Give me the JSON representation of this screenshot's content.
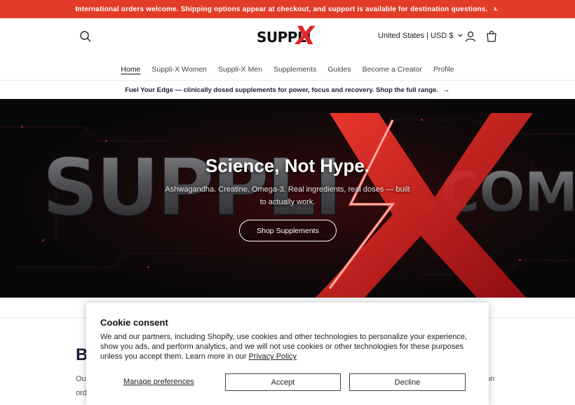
{
  "announcement": {
    "text": "International orders welcome. Shipping options appear at checkout, and support is available for destination questions.",
    "arrow": "→",
    "prev": "‹",
    "next": "›"
  },
  "header": {
    "logo_text": "SUPPLI",
    "logo_x": "X",
    "country_selector": "United States | USD $",
    "icons": [
      "search-icon",
      "account-icon",
      "cart-icon"
    ]
  },
  "nav": {
    "items": [
      {
        "label": "Home",
        "active": true
      },
      {
        "label": "Suppli-X Women"
      },
      {
        "label": "Suppli-X Men"
      },
      {
        "label": "Supplements"
      },
      {
        "label": "Guides"
      },
      {
        "label": "Become a Creator"
      },
      {
        "label": "Profile"
      }
    ]
  },
  "promo": {
    "text": "Fuel Your Edge — clinically dosed supplements for power, focus and recovery. Shop the full range.",
    "arrow": "→"
  },
  "hero": {
    "background_text": "SUPPLI-X.COM",
    "title": "Science, Not Hype.",
    "subtitle": "Ashwagandha. Creatine. Omega-3. Real ingredients, real doses — built to actually work.",
    "button": "Shop Supplements",
    "accent": "#e0262a"
  },
  "below": {
    "heading": "B",
    "text1": "Ou",
    "text2": "ord",
    "text3": "on"
  },
  "cookie": {
    "title": "Cookie consent",
    "body": "We and our partners, including Shopify, use cookies and other technologies to personalize your experience, show you ads, and perform analytics, and we will not use cookies or other technologies for these purposes unless you accept them. Learn more in our",
    "policy_link": "Privacy Policy",
    "manage": "Manage preferences",
    "accept": "Accept",
    "decline": "Decline"
  },
  "colors": {
    "announcement_bg": "#e23b26",
    "brand_red": "#e0262a",
    "heading_navy": "#1c1c3a"
  }
}
